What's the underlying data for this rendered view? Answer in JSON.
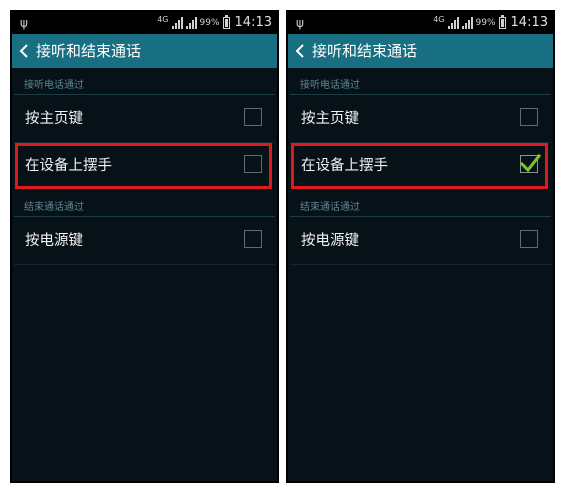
{
  "screens": [
    {
      "status": {
        "usb": "ψ",
        "network": "4G",
        "battery": "99%",
        "time": "14:13"
      },
      "title": "接听和结束通话",
      "section1": "接听电话通过",
      "option_home": {
        "label": "按主页键",
        "checked": false
      },
      "option_wave": {
        "label": "在设备上摆手",
        "checked": false
      },
      "section2": "结束通话通过",
      "option_power": {
        "label": "按电源键",
        "checked": false
      }
    },
    {
      "status": {
        "usb": "ψ",
        "network": "4G",
        "battery": "99%",
        "time": "14:13"
      },
      "title": "接听和结束通话",
      "section1": "接听电话通过",
      "option_home": {
        "label": "按主页键",
        "checked": false
      },
      "option_wave": {
        "label": "在设备上摆手",
        "checked": true
      },
      "section2": "结束通话通过",
      "option_power": {
        "label": "按电源键",
        "checked": false
      }
    }
  ],
  "colors": {
    "action_bar": "#176f81",
    "background": "#061118",
    "highlight": "#e0191b",
    "checkmark": "#7cc52a"
  }
}
